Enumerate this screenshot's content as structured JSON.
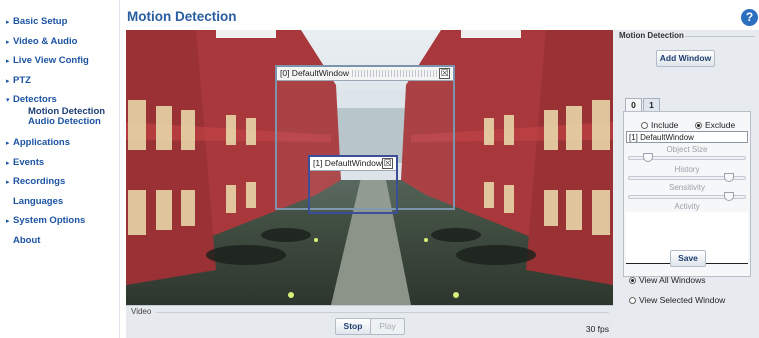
{
  "sidebar": {
    "items": [
      {
        "label": "Basic Setup"
      },
      {
        "label": "Video & Audio"
      },
      {
        "label": "Live View Config"
      },
      {
        "label": "PTZ"
      },
      {
        "label": "Detectors",
        "children": [
          "Motion Detection",
          "Audio Detection"
        ]
      },
      {
        "label": "Applications"
      },
      {
        "label": "Events"
      },
      {
        "label": "Recordings"
      },
      {
        "label": "Languages"
      },
      {
        "label": "System Options"
      },
      {
        "label": "About"
      }
    ]
  },
  "header": {
    "title": "Motion Detection",
    "help_icon": "?"
  },
  "video": {
    "windows": [
      {
        "title": "[0] DefaultWindow",
        "close": "☒"
      },
      {
        "title": "[1] DefaultWindow",
        "close": "☒"
      }
    ],
    "legend": "Video",
    "stop_label": "Stop",
    "play_label": "Play",
    "fps": "30 fps"
  },
  "panel": {
    "legend": "Motion Detection",
    "add_window_label": "Add Window",
    "tabs": [
      "0",
      "1"
    ],
    "include_label": "Include",
    "exclude_label": "Exclude",
    "exclude_selected": true,
    "window_name": "[1] DefaultWindow",
    "object_size_label": "Object Size",
    "history_label": "History",
    "sensitivity_label": "Sensitivity",
    "activity_label": "Activity",
    "object_size_level": 0.13,
    "history_level": 0.9,
    "sensitivity_level": 0.9,
    "save_label": "Save",
    "view_all_label": "View All Windows",
    "view_selected_label": "View Selected Window",
    "view_all_selected": true
  },
  "colors": {
    "link": "#1c54a3",
    "title": "#2a5da0",
    "panel_bg": "#e7ebef",
    "building_red": "#a8383b"
  }
}
